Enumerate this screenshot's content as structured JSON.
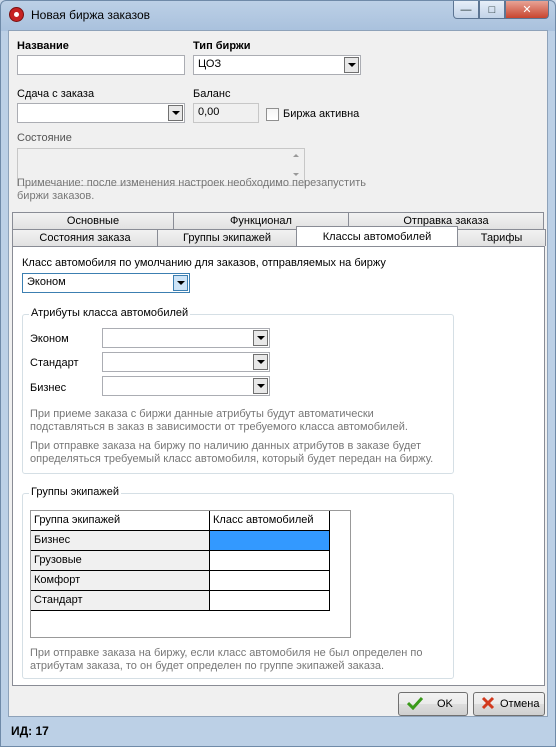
{
  "window": {
    "title": "Новая биржа заказов"
  },
  "form": {
    "name_label": "Название",
    "name_value": "",
    "exchange_type_label": "Тип биржи",
    "exchange_type_value": "ЦОЗ",
    "order_cost_label": "Сдача с заказа",
    "order_cost_value": "",
    "balance_label": "Баланс",
    "balance_value": "0,00",
    "active_label": "Биржа активна",
    "active_checked": false,
    "state_label": "Состояние",
    "state_value": "",
    "restart_note": "Примечание: после изменения настроек необходимо перезапустить биржи заказов."
  },
  "tabs": {
    "row1": [
      "Основные",
      "Функционал",
      "Отправка заказа"
    ],
    "row2": [
      "Состояния заказа",
      "Группы экипажей",
      "Классы автомобилей",
      "Тарифы"
    ],
    "active": "Классы автомобилей"
  },
  "car_classes": {
    "default_label": "Класс автомобиля по умолчанию для заказов, отправляемых на биржу",
    "default_value": "Эконом",
    "attributes_group_title": "Атрибуты класса автомобилей",
    "attributes": [
      {
        "label": "Эконом",
        "value": ""
      },
      {
        "label": "Стандарт",
        "value": ""
      },
      {
        "label": "Бизнес",
        "value": ""
      }
    ],
    "attributes_note1": "При приеме заказа с биржи данные атрибуты будут автоматически подставляться в заказ в зависимости от требуемого класса автомобилей.",
    "attributes_note2": "При отправке заказа на биржу по наличию данных атрибутов в заказе будет определяться требуемый класс автомобиля, который будет передан на биржу.",
    "crews_group_title": "Группы экипажей",
    "grid_headers": [
      "Группа экипажей",
      "Класс автомобилей"
    ],
    "grid_rows": [
      {
        "group": "Бизнес",
        "class": ""
      },
      {
        "group": "Грузовые",
        "class": ""
      },
      {
        "group": "Комфорт",
        "class": ""
      },
      {
        "group": "Стандарт",
        "class": ""
      }
    ],
    "crews_note": "При отправке заказа на биржу, если класс автомобиля не был определен по атрибутам заказа, то он будет определен по группе экипажей заказа."
  },
  "buttons": {
    "ok": "OK",
    "cancel": "Отмена"
  },
  "status": {
    "id_text": "ИД: 17"
  },
  "colors": {
    "selection": "#3399ff",
    "ok_icon": "#3a9a1a",
    "cancel_icon": "#d23a1e"
  }
}
